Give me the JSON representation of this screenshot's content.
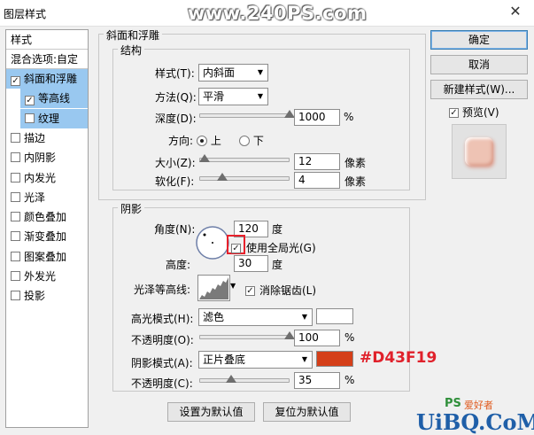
{
  "window": {
    "title": "图层样式",
    "watermark": "www.240PS.com",
    "close_glyph": "✕"
  },
  "sidebar": {
    "header": "样式",
    "blend_options": "混合选项:自定",
    "items": [
      {
        "label": "斜面和浮雕",
        "checked": true,
        "selected": true,
        "sub": false
      },
      {
        "label": "等高线",
        "checked": true,
        "selected": true,
        "sub": true
      },
      {
        "label": "纹理",
        "checked": false,
        "selected": true,
        "sub": true
      },
      {
        "label": "描边",
        "checked": false,
        "selected": false,
        "sub": false
      },
      {
        "label": "内阴影",
        "checked": false,
        "selected": false,
        "sub": false
      },
      {
        "label": "内发光",
        "checked": false,
        "selected": false,
        "sub": false
      },
      {
        "label": "光泽",
        "checked": false,
        "selected": false,
        "sub": false
      },
      {
        "label": "颜色叠加",
        "checked": false,
        "selected": false,
        "sub": false
      },
      {
        "label": "渐变叠加",
        "checked": false,
        "selected": false,
        "sub": false
      },
      {
        "label": "图案叠加",
        "checked": false,
        "selected": false,
        "sub": false
      },
      {
        "label": "外发光",
        "checked": false,
        "selected": false,
        "sub": false
      },
      {
        "label": "投影",
        "checked": false,
        "selected": false,
        "sub": false
      }
    ]
  },
  "bevel": {
    "section_title": "斜面和浮雕",
    "structure_title": "结构",
    "style_label": "样式(T):",
    "style_value": "内斜面",
    "technique_label": "方法(Q):",
    "technique_value": "平滑",
    "depth_label": "深度(D):",
    "depth_value": "1000",
    "depth_unit": "%",
    "depth_level": 1.0,
    "direction_label": "方向:",
    "direction_up": "上",
    "direction_down": "下",
    "size_label": "大小(Z):",
    "size_value": "12",
    "size_unit": "像素",
    "size_level": 0.06,
    "soften_label": "软化(F):",
    "soften_value": "4",
    "soften_unit": "像素",
    "soften_level": 0.25
  },
  "shading": {
    "title": "阴影",
    "angle_label": "角度(N):",
    "angle_value": "120",
    "angle_unit": "度",
    "global_light_label": "使用全局光(G)",
    "altitude_label": "高度:",
    "altitude_value": "30",
    "altitude_unit": "度",
    "gloss_label": "光泽等高线:",
    "antialias_label": "消除锯齿(L)",
    "highlight_mode_label": "高光模式(H):",
    "highlight_mode_value": "滤色",
    "highlight_color": "#ffffff",
    "highlight_opacity_label": "不透明度(O):",
    "highlight_opacity_value": "100",
    "highlight_opacity_level": 1.0,
    "shadow_mode_label": "阴影模式(A):",
    "shadow_mode_value": "正片叠底",
    "shadow_color": "#d43f19",
    "shadow_color_annotation": "#D43F19",
    "shadow_opacity_label": "不透明度(C):",
    "shadow_opacity_value": "35",
    "shadow_opacity_level": 0.35,
    "percent": "%"
  },
  "bottom_buttons": {
    "make_default": "设置为默认值",
    "reset_default": "复位为默认值"
  },
  "right_panel": {
    "ok": "确定",
    "cancel": "取消",
    "new_style": "新建样式(W)...",
    "preview_label": "预览(V)"
  },
  "corner_watermark": {
    "ps_text": "PS",
    "cn_text": "爱好者",
    "url": "UiBQ.CoM"
  }
}
